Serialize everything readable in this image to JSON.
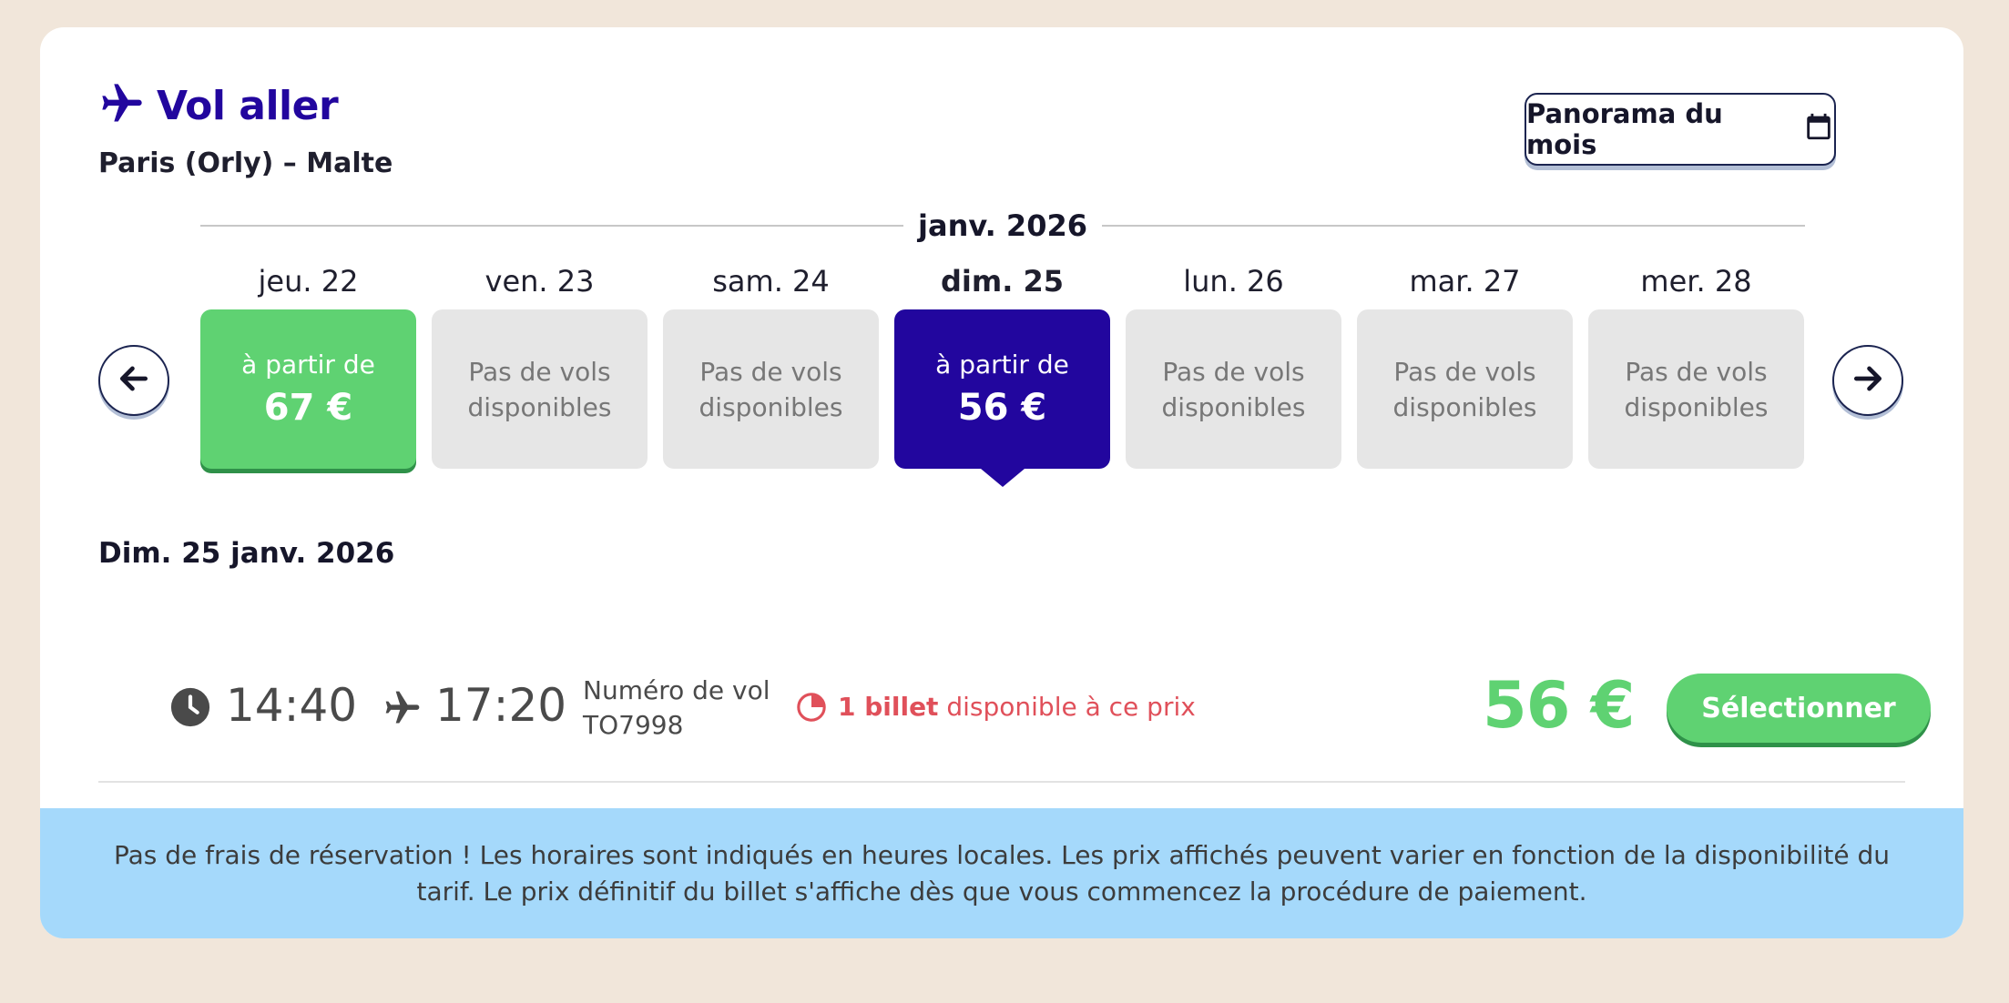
{
  "header": {
    "title": "Vol aller",
    "route": "Paris (Orly) – Malte"
  },
  "panorama_button": {
    "label": "Panorama du mois",
    "icon": "calendar-icon"
  },
  "calendar": {
    "month": "janv. 2026",
    "days": [
      {
        "label": "jeu. 22",
        "status": "price",
        "from": "à partir de",
        "price": "67 €",
        "selected": false
      },
      {
        "label": "ven. 23",
        "status": "none",
        "text_line1": "Pas de vols",
        "text_line2": "disponibles",
        "selected": false
      },
      {
        "label": "sam. 24",
        "status": "none",
        "text_line1": "Pas de vols",
        "text_line2": "disponibles",
        "selected": false
      },
      {
        "label": "dim. 25",
        "status": "price",
        "from": "à partir de",
        "price": "56 €",
        "selected": true
      },
      {
        "label": "lun. 26",
        "status": "none",
        "text_line1": "Pas de vols",
        "text_line2": "disponibles",
        "selected": false
      },
      {
        "label": "mar. 27",
        "status": "none",
        "text_line1": "Pas de vols",
        "text_line2": "disponibles",
        "selected": false
      },
      {
        "label": "mer. 28",
        "status": "none",
        "text_line1": "Pas de vols",
        "text_line2": "disponibles",
        "selected": false
      }
    ]
  },
  "selected_date": "Dim. 25 janv. 2026",
  "flight": {
    "departure": "14:40",
    "arrival": "17:20",
    "flight_number_label": "Numéro de vol",
    "flight_number": "TO7998",
    "availability_count": "1 billet",
    "availability_text": " disponible à ce prix",
    "price": "56 €",
    "select_label": "Sélectionner"
  },
  "footer": {
    "text": "Pas de frais de réservation ! Les horaires sont indiqués en heures locales. Les prix affichés peuvent varier en fonction de la disponibilité du tarif. Le prix définitif du billet s'affiche dès que vous commencez la procédure de paiement."
  },
  "colors": {
    "brand": "#22069e",
    "green": "#5fd272",
    "alert": "#e0505a",
    "footer_bg": "#a5d9fb"
  }
}
